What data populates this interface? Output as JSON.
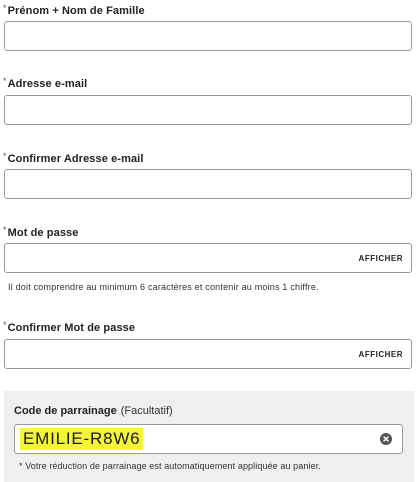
{
  "form": {
    "required_marker": "*",
    "full_name": {
      "label": "Prénom + Nom de Famille",
      "value": ""
    },
    "email": {
      "label": "Adresse e-mail",
      "value": ""
    },
    "confirm_email": {
      "label": "Confirmer Adresse e-mail",
      "value": ""
    },
    "password": {
      "label": "Mot de passe",
      "value": "",
      "show_label": "AFFICHER",
      "hint": "Il doit comprendre au minimum 6 caractères et contenir au moins 1 chiffre."
    },
    "confirm_password": {
      "label": "Confirmer Mot de passe",
      "value": "",
      "show_label": "AFFICHER"
    },
    "referral": {
      "label": "Code de parrainage",
      "optional": "(Facultatif)",
      "value": "EMILIE-R8W6",
      "clear_icon": "clear-circle-x-icon",
      "highlight_color": "#f5f537",
      "note": "* Votre réduction de parrainage est automatiquement appliquée au panier."
    }
  }
}
